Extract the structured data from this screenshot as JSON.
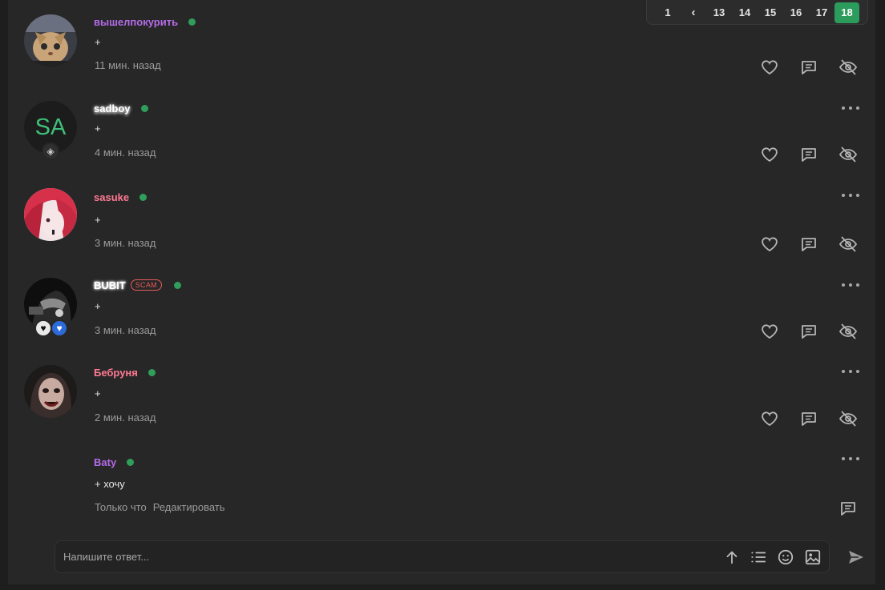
{
  "pagination": {
    "items": [
      "1",
      "‹",
      "13",
      "14",
      "15",
      "16",
      "17",
      "18"
    ],
    "active": "18"
  },
  "colors": {
    "accent": "#2c9c5c",
    "online": "#2f9e5c",
    "scam": "#e85a5a",
    "name_purple": "#b46be8",
    "name_white": "#ffffff",
    "name_pink": "#ff7a93"
  },
  "comments": [
    {
      "username": "вышелпокурить",
      "text": "+",
      "time": "11 мин. назад"
    },
    {
      "username": "sadboy",
      "avatar_letters": "SA",
      "text": "+",
      "time": "4 мин. назад"
    },
    {
      "username": "sasuke",
      "text": "+",
      "time": "3 мин. назад"
    },
    {
      "username": "BUBIT",
      "badge": "SCAM",
      "text": "+",
      "time": "3 мин. назад"
    },
    {
      "username": "Бебруня",
      "text": "+",
      "time": "2 мин. назад"
    },
    {
      "username": "Baty",
      "text": "+ хочу",
      "time": "Только что",
      "edit_label": "Редактировать"
    }
  ],
  "reply": {
    "placeholder": "Напишите ответ..."
  },
  "icons": {
    "like": "heart-icon",
    "reply": "comment-icon",
    "hide": "eye-off-icon",
    "more": "more-dots-icon",
    "toolbar": [
      "arrow-up-icon",
      "list-icon",
      "emoji-icon",
      "image-icon"
    ],
    "send": "send-icon"
  }
}
